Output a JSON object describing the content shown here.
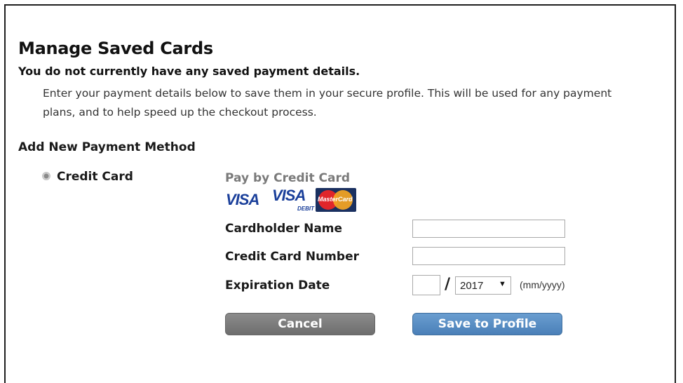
{
  "page": {
    "title": "Manage Saved Cards",
    "subtitle": "You do not currently have any saved payment details.",
    "description": "Enter your payment details below to save them in your secure profile. This will be used for any payment plans, and to help speed up the checkout process."
  },
  "payment_method": {
    "heading": "Add New Payment Method",
    "option_label": "Credit Card",
    "selected": true
  },
  "card_form": {
    "title": "Pay by Credit Card",
    "logos": {
      "visa": "VISA",
      "visa_debit": "VISA",
      "visa_debit_sub": "DEBIT",
      "mastercard": "MasterCard"
    },
    "cardholder_label": "Cardholder Name",
    "cardholder_value": "",
    "card_number_label": "Credit Card Number",
    "card_number_value": "",
    "expiration_label": "Expiration Date",
    "month_value": "",
    "slash": "/",
    "year_value": "2017",
    "date_format_hint": "(mm/yyyy)",
    "cancel_label": "Cancel",
    "save_label": "Save to Profile"
  },
  "colors": {
    "visa_blue": "#1a3f9a",
    "save_button": "#4a7fb8",
    "cancel_button": "#7a7a7a"
  },
  "icons": {
    "radio": "radio-selected-icon",
    "year_dropdown": "dropdown-arrow-icon"
  }
}
